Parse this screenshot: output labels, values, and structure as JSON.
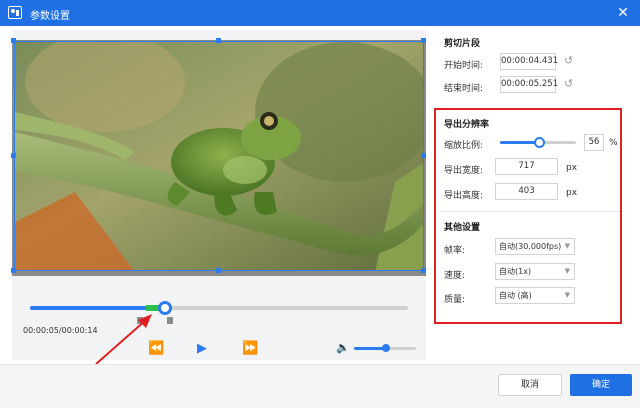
{
  "window": {
    "title": "参数设置",
    "close_glyph": "✕"
  },
  "player": {
    "timecode": "00:00:05/00:00:14",
    "progress_fraction": 0.37,
    "volume_fraction": 0.53,
    "icons": {
      "rewind": "⏪",
      "play": "▶",
      "forward": "⏩",
      "volume": "🔈"
    }
  },
  "clip": {
    "section_title": "剪切片段",
    "start_label": "开始时间:",
    "start_value": "00:00:04.431",
    "end_label": "结束时间:",
    "end_value": "00:00:05.251",
    "reset_glyph": "↺"
  },
  "export": {
    "section_title": "导出分辨率",
    "scale_label": "缩放比例:",
    "scale_value": "56",
    "scale_unit": "%",
    "scale_fraction": 0.56,
    "width_label": "导出宽度:",
    "width_value": "717",
    "height_label": "导出高度:",
    "height_value": "403",
    "unit_px": "px"
  },
  "other": {
    "section_title": "其他设置",
    "fps_label": "帧率:",
    "fps_value": "自动(30.000fps)",
    "speed_label": "速度:",
    "speed_value": "自动(1x)",
    "quality_label": "质量:",
    "quality_value": "自动 (高)",
    "caret": "▼"
  },
  "footer": {
    "cancel_label": "取消",
    "ok_label": "确定"
  },
  "colors": {
    "accent": "#1f6fe5",
    "highlight": "#e02020",
    "segment": "#2ac14a"
  }
}
